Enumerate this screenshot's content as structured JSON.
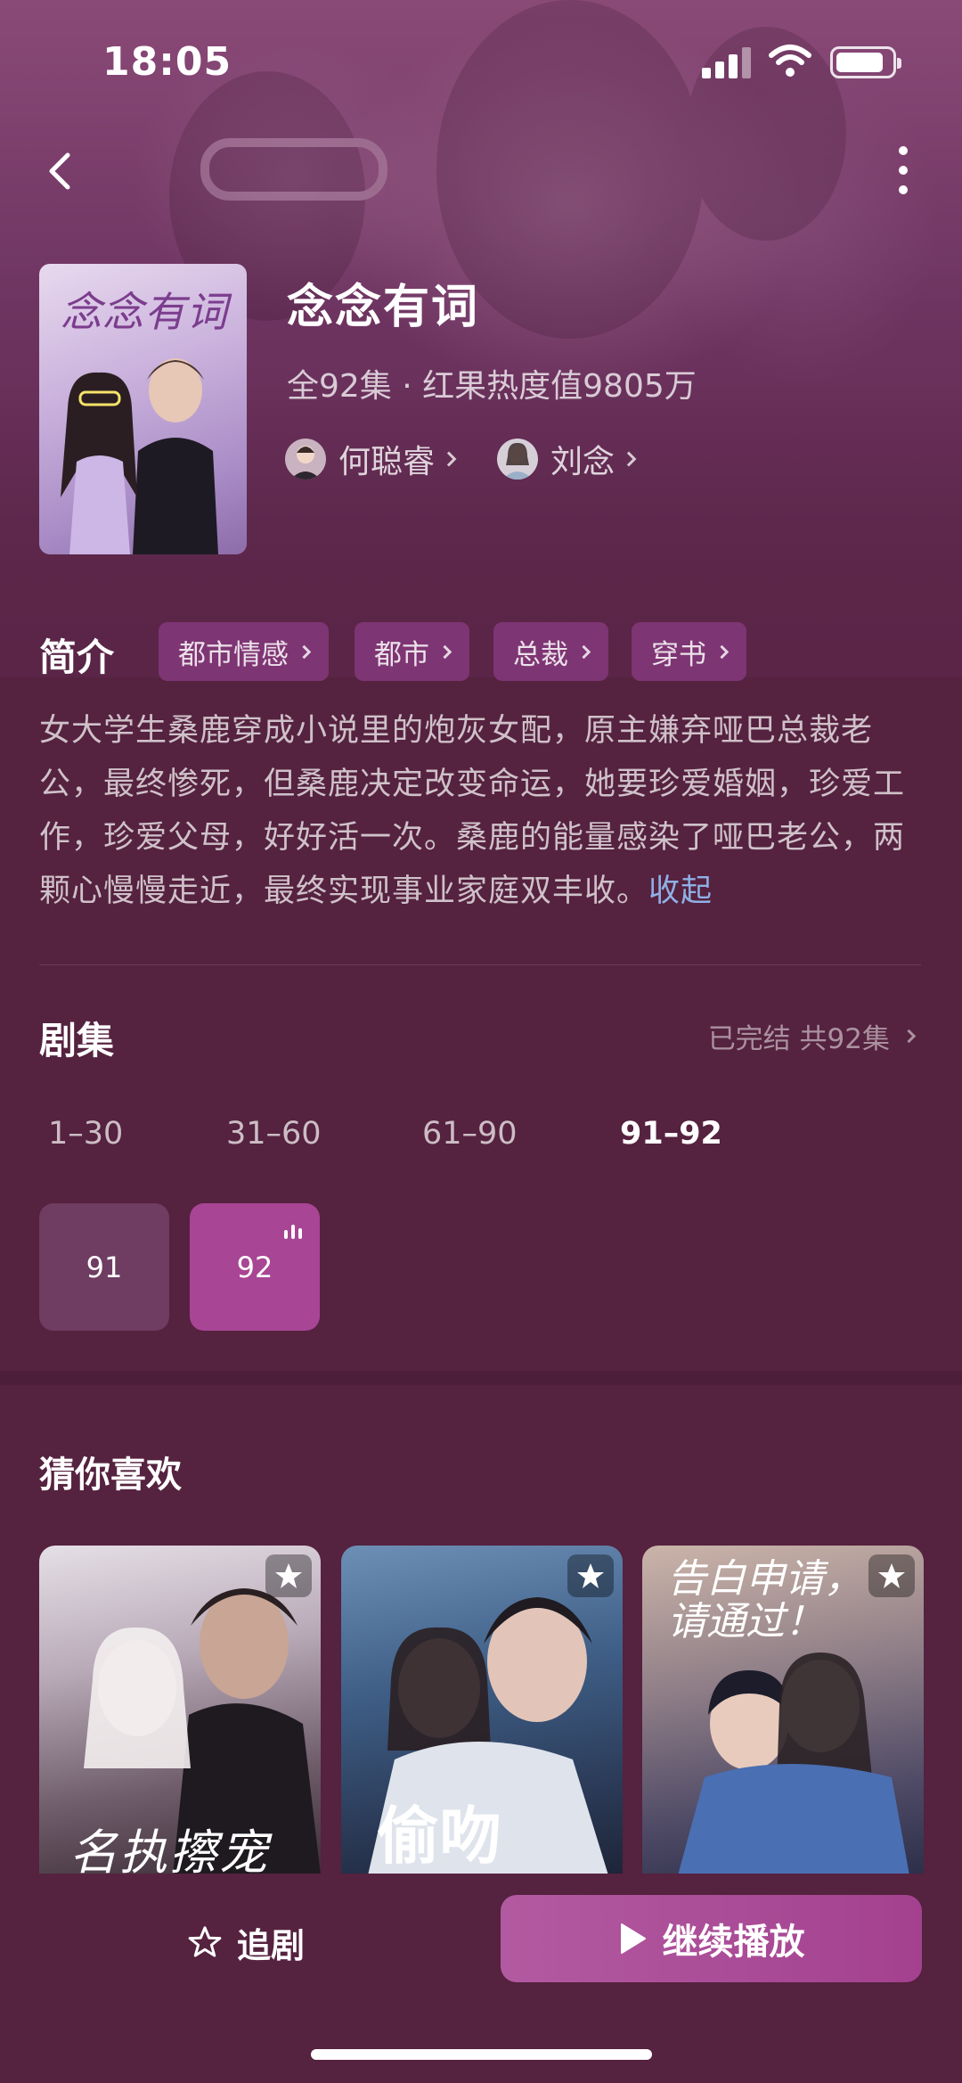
{
  "status_bar": {
    "time": "18:05"
  },
  "drama": {
    "title": "念念有词",
    "poster_text": "念念有词",
    "meta": "全92集 · 红果热度值9805万",
    "actors": [
      {
        "name": "何聪睿"
      },
      {
        "name": "刘念"
      }
    ]
  },
  "intro": {
    "label": "简介",
    "tags": [
      "都市情感",
      "都市",
      "总裁",
      "穿书"
    ],
    "text": "女大学生桑鹿穿成小说里的炮灰女配，原主嫌弃哑巴总裁老公，最终惨死，但桑鹿决定改变命运，她要珍爱婚姻，珍爱工作，珍爱父母，好好活一次。桑鹿的能量感染了哑巴老公，两颗心慢慢走近，最终实现事业家庭双丰收。",
    "collapse_label": "收起"
  },
  "episodes": {
    "label": "剧集",
    "status": "已完结 共92集",
    "ranges": [
      "1–30",
      "31–60",
      "61–90",
      "91–92"
    ],
    "active_range": "91–92",
    "items": [
      {
        "number": "91",
        "playing": false
      },
      {
        "number": "92",
        "playing": true
      }
    ]
  },
  "recommend": {
    "label": "猜你喜欢",
    "items": [
      {
        "poster_text": "名执擦宠"
      },
      {
        "poster_text": "偷吻"
      },
      {
        "poster_text": "告白申请，请通过！"
      }
    ]
  },
  "bottom_bar": {
    "follow_label": "追剧",
    "play_label": "继续播放"
  },
  "colors": {
    "background": "#55223f",
    "tag_background": "#7e3573",
    "active_episode": "#a84594",
    "link": "#8fb0e6",
    "play_button": "#a4418f"
  }
}
